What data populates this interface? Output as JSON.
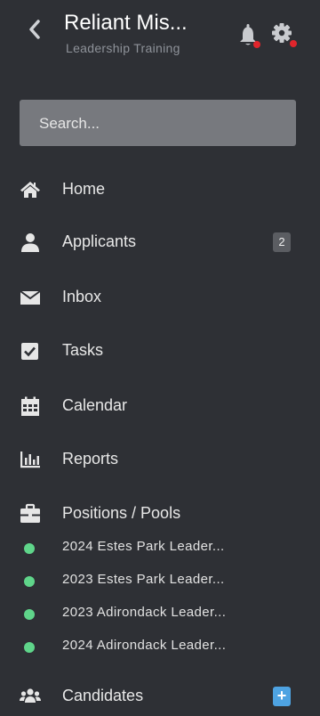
{
  "header": {
    "title": "Reliant Mis...",
    "subtitle": "Leadership Training"
  },
  "colors": {
    "background": "#2e3035",
    "search_bg": "#77797e",
    "notification_dot": "#e0252c",
    "status_green": "#5fd58a",
    "plus_badge": "#4ea3e2"
  },
  "search": {
    "placeholder": "Search..."
  },
  "nav": [
    {
      "label": "Home",
      "icon": "home-icon"
    },
    {
      "label": "Applicants",
      "icon": "user-icon",
      "badge": "2"
    },
    {
      "label": "Inbox",
      "icon": "envelope-icon"
    },
    {
      "label": "Tasks",
      "icon": "checkbox-icon"
    },
    {
      "label": "Calendar",
      "icon": "calendar-icon"
    },
    {
      "label": "Reports",
      "icon": "bar-chart-icon"
    },
    {
      "label": "Positions / Pools",
      "icon": "briefcase-icon"
    }
  ],
  "positions": [
    {
      "label": "2024 Estes Park Leader..."
    },
    {
      "label": "2023 Estes Park Leader..."
    },
    {
      "label": "2023 Adirondack Leader..."
    },
    {
      "label": "2024 Adirondack Leader..."
    }
  ],
  "candidates": {
    "label": "Candidates",
    "icon": "users-icon",
    "action": "+"
  }
}
